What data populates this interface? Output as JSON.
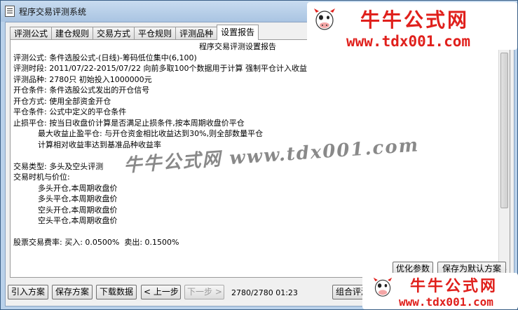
{
  "window": {
    "title": "程序交易评测系统",
    "close_glyph": "✕"
  },
  "tabs": [
    {
      "label": "评测公式",
      "active": false
    },
    {
      "label": "建仓规则",
      "active": false
    },
    {
      "label": "交易方式",
      "active": false
    },
    {
      "label": "平仓规则",
      "active": false
    },
    {
      "label": "评测品种",
      "active": false
    },
    {
      "label": "设置报告",
      "active": true
    }
  ],
  "report": {
    "title": "程序交易评测设置报告",
    "lines": [
      "评测公式: 条件选股公式-(日线)-筹码低位集中(6,100)",
      "评测时段: 2011/07/22-2015/07/22 向前多取100个数据用于计算 强制平仓计入收益",
      "评测品种: 2780只 初始投入1000000元",
      "开仓条件: 条件选股公式发出的开仓信号",
      "开仓方式: 使用全部资金开仓",
      "平仓条件: 公式中定义的平仓条件",
      "止损平仓: 按当日收盘价计算是否满足止损条件,按本周期收盘价平仓",
      "          最大收益止盈平仓: 与开仓资金相比收益达到30%,则全部数量平仓",
      "          计算相对收益率达到基准品种收益率",
      "",
      "交易类型: 多头及空头评测",
      "交易时机与价位:",
      "          多头开仓,本周期收盘价",
      "          多头平仓,本周期收盘价",
      "          空头开仓,本周期收盘价",
      "          空头平仓,本周期收盘价",
      "",
      "股票交易费率: 买入: 0.0500%  卖出: 0.1500%"
    ]
  },
  "buttons": {
    "optimize": "优化参数",
    "save_default": "保存为默认方案",
    "import": "引入方案",
    "save": "保存方案",
    "download": "下载数据",
    "prev": "< 上一步",
    "next": "下一步 >",
    "combo": "组合评测"
  },
  "status": "2780/2780 01:23",
  "watermark": {
    "brand": "牛牛公式网",
    "url": "www.tdx001.com",
    "center": "牛牛公式网 www.tdx001.com"
  },
  "colors": {
    "watermark_red": "#e0201c",
    "title_bar": "#b9d1ea",
    "close_red": "#c24a33"
  }
}
